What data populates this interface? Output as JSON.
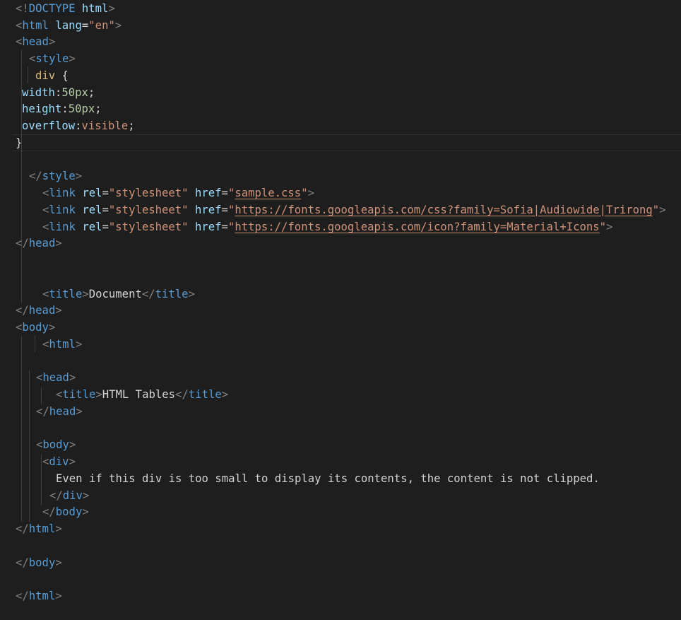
{
  "editor": {
    "lines": [
      {
        "tokens": [
          {
            "t": "<!",
            "c": "tp"
          },
          {
            "t": "DOCTYPE",
            "c": "tn"
          },
          {
            "t": " ",
            "c": "pl"
          },
          {
            "t": "html",
            "c": "an"
          },
          {
            "t": ">",
            "c": "tp"
          }
        ]
      },
      {
        "tokens": [
          {
            "t": "<",
            "c": "tp"
          },
          {
            "t": "html",
            "c": "tn"
          },
          {
            "t": " ",
            "c": "pl"
          },
          {
            "t": "lang",
            "c": "an"
          },
          {
            "t": "=",
            "c": "pl"
          },
          {
            "t": "\"en\"",
            "c": "av"
          },
          {
            "t": ">",
            "c": "tp"
          }
        ]
      },
      {
        "tokens": [
          {
            "t": "<",
            "c": "tp"
          },
          {
            "t": "head",
            "c": "tn"
          },
          {
            "t": ">",
            "c": "tp"
          }
        ]
      },
      {
        "tokens": [
          {
            "t": "<",
            "c": "tp"
          },
          {
            "t": "style",
            "c": "tn"
          },
          {
            "t": ">",
            "c": "tp"
          }
        ]
      },
      {
        "tokens": [
          {
            "t": "div",
            "c": "sel"
          },
          {
            "t": " {",
            "c": "pl"
          }
        ]
      },
      {
        "tokens": [
          {
            "t": "width",
            "c": "pr"
          },
          {
            "t": ":",
            "c": "pl"
          },
          {
            "t": "50px",
            "c": "num"
          },
          {
            "t": ";",
            "c": "pl"
          }
        ]
      },
      {
        "tokens": [
          {
            "t": "height",
            "c": "pr"
          },
          {
            "t": ":",
            "c": "pl"
          },
          {
            "t": "50px",
            "c": "num"
          },
          {
            "t": ";",
            "c": "pl"
          }
        ]
      },
      {
        "tokens": [
          {
            "t": "overflow",
            "c": "pr"
          },
          {
            "t": ":",
            "c": "pl"
          },
          {
            "t": "visible",
            "c": "kw"
          },
          {
            "t": ";",
            "c": "pl"
          }
        ]
      },
      {
        "tokens": [
          {
            "t": "}",
            "c": "pl"
          }
        ]
      },
      {
        "tokens": []
      },
      {
        "tokens": [
          {
            "t": "</",
            "c": "tp"
          },
          {
            "t": "style",
            "c": "tn"
          },
          {
            "t": ">",
            "c": "tp"
          }
        ]
      },
      {
        "tokens": [
          {
            "t": "<",
            "c": "tp"
          },
          {
            "t": "link",
            "c": "tn"
          },
          {
            "t": " ",
            "c": "pl"
          },
          {
            "t": "rel",
            "c": "an"
          },
          {
            "t": "=",
            "c": "pl"
          },
          {
            "t": "\"stylesheet\"",
            "c": "av"
          },
          {
            "t": " ",
            "c": "pl"
          },
          {
            "t": "href",
            "c": "an"
          },
          {
            "t": "=",
            "c": "pl"
          },
          {
            "t": "\"",
            "c": "av"
          },
          {
            "t": "sample.css",
            "c": "ln"
          },
          {
            "t": "\"",
            "c": "av"
          },
          {
            "t": ">",
            "c": "tp"
          }
        ]
      },
      {
        "tokens": [
          {
            "t": "<",
            "c": "tp"
          },
          {
            "t": "link",
            "c": "tn"
          },
          {
            "t": " ",
            "c": "pl"
          },
          {
            "t": "rel",
            "c": "an"
          },
          {
            "t": "=",
            "c": "pl"
          },
          {
            "t": "\"stylesheet\"",
            "c": "av"
          },
          {
            "t": " ",
            "c": "pl"
          },
          {
            "t": "href",
            "c": "an"
          },
          {
            "t": "=",
            "c": "pl"
          },
          {
            "t": "\"",
            "c": "av"
          },
          {
            "t": "https://fonts.googleapis.com/css?family=Sofia|Audiowide|Trirong",
            "c": "ln"
          },
          {
            "t": "\"",
            "c": "av"
          },
          {
            "t": ">",
            "c": "tp"
          }
        ]
      },
      {
        "tokens": [
          {
            "t": "<",
            "c": "tp"
          },
          {
            "t": "link",
            "c": "tn"
          },
          {
            "t": " ",
            "c": "pl"
          },
          {
            "t": "rel",
            "c": "an"
          },
          {
            "t": "=",
            "c": "pl"
          },
          {
            "t": "\"stylesheet\"",
            "c": "av"
          },
          {
            "t": " ",
            "c": "pl"
          },
          {
            "t": "href",
            "c": "an"
          },
          {
            "t": "=",
            "c": "pl"
          },
          {
            "t": "\"",
            "c": "av"
          },
          {
            "t": "https://fonts.googleapis.com/icon?family=Material+Icons",
            "c": "ln"
          },
          {
            "t": "\"",
            "c": "av"
          },
          {
            "t": ">",
            "c": "tp"
          }
        ]
      },
      {
        "tokens": [
          {
            "t": "</",
            "c": "tp"
          },
          {
            "t": "head",
            "c": "tn"
          },
          {
            "t": ">",
            "c": "tp"
          }
        ]
      },
      {
        "tokens": []
      },
      {
        "tokens": []
      },
      {
        "tokens": [
          {
            "t": "<",
            "c": "tp"
          },
          {
            "t": "title",
            "c": "tn"
          },
          {
            "t": ">",
            "c": "tp"
          },
          {
            "t": "Document",
            "c": "pl"
          },
          {
            "t": "</",
            "c": "tp"
          },
          {
            "t": "title",
            "c": "tn"
          },
          {
            "t": ">",
            "c": "tp"
          }
        ]
      },
      {
        "tokens": [
          {
            "t": "</",
            "c": "tp"
          },
          {
            "t": "head",
            "c": "tn"
          },
          {
            "t": ">",
            "c": "tp"
          }
        ]
      },
      {
        "tokens": [
          {
            "t": "<",
            "c": "tp"
          },
          {
            "t": "body",
            "c": "tn"
          },
          {
            "t": ">",
            "c": "tp"
          }
        ]
      },
      {
        "tokens": [
          {
            "t": "<",
            "c": "tp"
          },
          {
            "t": "html",
            "c": "tn"
          },
          {
            "t": ">",
            "c": "tp"
          }
        ]
      },
      {
        "tokens": []
      },
      {
        "tokens": [
          {
            "t": "<",
            "c": "tp"
          },
          {
            "t": "head",
            "c": "tn"
          },
          {
            "t": ">",
            "c": "tp"
          }
        ]
      },
      {
        "tokens": [
          {
            "t": "<",
            "c": "tp"
          },
          {
            "t": "title",
            "c": "tn"
          },
          {
            "t": ">",
            "c": "tp"
          },
          {
            "t": "HTML Tables",
            "c": "pl"
          },
          {
            "t": "</",
            "c": "tp"
          },
          {
            "t": "title",
            "c": "tn"
          },
          {
            "t": ">",
            "c": "tp"
          }
        ]
      },
      {
        "tokens": [
          {
            "t": "</",
            "c": "tp"
          },
          {
            "t": "head",
            "c": "tn"
          },
          {
            "t": ">",
            "c": "tp"
          }
        ]
      },
      {
        "tokens": []
      },
      {
        "tokens": [
          {
            "t": "<",
            "c": "tp"
          },
          {
            "t": "body",
            "c": "tn"
          },
          {
            "t": ">",
            "c": "tp"
          }
        ]
      },
      {
        "tokens": [
          {
            "t": "<",
            "c": "tp"
          },
          {
            "t": "div",
            "c": "tn"
          },
          {
            "t": ">",
            "c": "tp"
          }
        ]
      },
      {
        "tokens": [
          {
            "t": "Even if this div is too small to display its contents, the content is not clipped.",
            "c": "pl"
          }
        ]
      },
      {
        "tokens": [
          {
            "t": "</",
            "c": "tp"
          },
          {
            "t": "div",
            "c": "tn"
          },
          {
            "t": ">",
            "c": "tp"
          }
        ]
      },
      {
        "tokens": [
          {
            "t": "</",
            "c": "tp"
          },
          {
            "t": "body",
            "c": "tn"
          },
          {
            "t": ">",
            "c": "tp"
          }
        ]
      },
      {
        "tokens": [
          {
            "t": "</",
            "c": "tp"
          },
          {
            "t": "html",
            "c": "tn"
          },
          {
            "t": ">",
            "c": "tp"
          }
        ]
      },
      {
        "tokens": []
      },
      {
        "tokens": [
          {
            "t": "</",
            "c": "tp"
          },
          {
            "t": "body",
            "c": "tn"
          },
          {
            "t": ">",
            "c": "tp"
          }
        ]
      },
      {
        "tokens": []
      },
      {
        "tokens": [
          {
            "t": "</",
            "c": "tp"
          },
          {
            "t": "html",
            "c": "tn"
          },
          {
            "t": ">",
            "c": "tp"
          }
        ]
      }
    ]
  },
  "colors": {
    "background": "#1e1e1e",
    "tag_punctuation": "#808080",
    "tag_name": "#569cd6",
    "attribute_name": "#9cdcfe",
    "attribute_value": "#ce9178",
    "plain_text": "#d4d4d4",
    "css_selector": "#d7ba7d",
    "css_number": "#b5cea8",
    "indent_guide": "#404040"
  }
}
